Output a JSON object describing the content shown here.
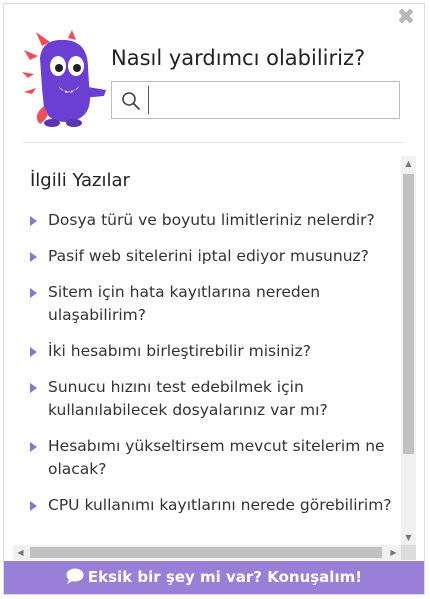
{
  "widget": {
    "title": "Nasıl yardımcı olabiliriz?",
    "search": {
      "value": "",
      "placeholder": ""
    },
    "section_title": "İlgili Yazılar",
    "articles": [
      "Dosya türü ve boyutu limitleriniz nelerdir?",
      "Pasif web sitelerini iptal ediyor musunuz?",
      "Sitem için hata kayıtlarına nereden ulaşabilirim?",
      "İki hesabımı birleştirebilir misiniz?",
      "Sunucu hızını test edebilmek için kullanılabilecek dosyalarınız var mı?",
      "Hesabımı yükseltirsem mevcut sitelerim ne olacak?",
      "CPU kullanımı kayıtlarını nerede görebilirim?"
    ],
    "footer_label": "Eksik bir şey mi var? Konuşalım!",
    "accent_color": "#9a7fd9",
    "icons": {
      "close": "close-icon",
      "search": "search-icon",
      "chat": "chat-icon",
      "mascot": "mascot-icon"
    }
  }
}
